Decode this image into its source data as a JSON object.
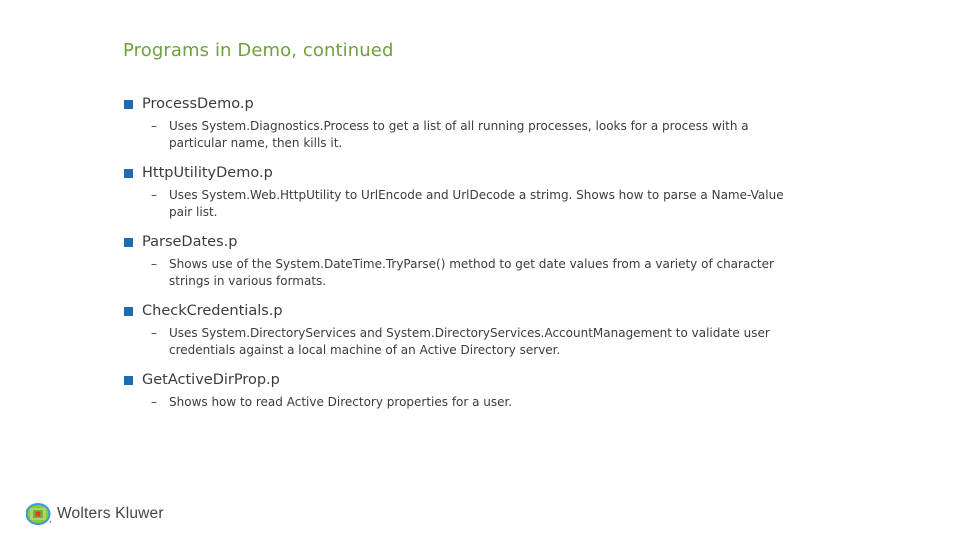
{
  "slide": {
    "title": "Programs in Demo, continued",
    "items": [
      {
        "name": "ProcessDemo.p",
        "description": "Uses System.Diagnostics.Process to get a list of all running processes, looks for a process with a particular name, then kills it."
      },
      {
        "name": "HttpUtilityDemo.p",
        "description": "Uses System.Web.HttpUtility to UrlEncode and UrlDecode a strimg. Shows how to parse a Name-Value pair list."
      },
      {
        "name": "ParseDates.p",
        "description": "Shows use of the System.DateTime.TryParse() method to get date values from a variety of character strings in various formats."
      },
      {
        "name": "CheckCredentials.p",
        "description": "Uses System.DirectoryServices and System.DirectoryServices.AccountManagement to validate user credentials against a local machine of an Active Directory server."
      },
      {
        "name": "GetActiveDirProp.p",
        "description": "Shows how to read Active Directory properties for a user."
      }
    ],
    "sub_bullet_glyph": "–"
  },
  "footer": {
    "logo_icon": "wolters-kluwer-globe-icon",
    "logo_text": "Wolters Kluwer"
  },
  "colors": {
    "title": "#6ea23a",
    "bullet": "#1f6bb0",
    "text": "#3c3c3c"
  }
}
